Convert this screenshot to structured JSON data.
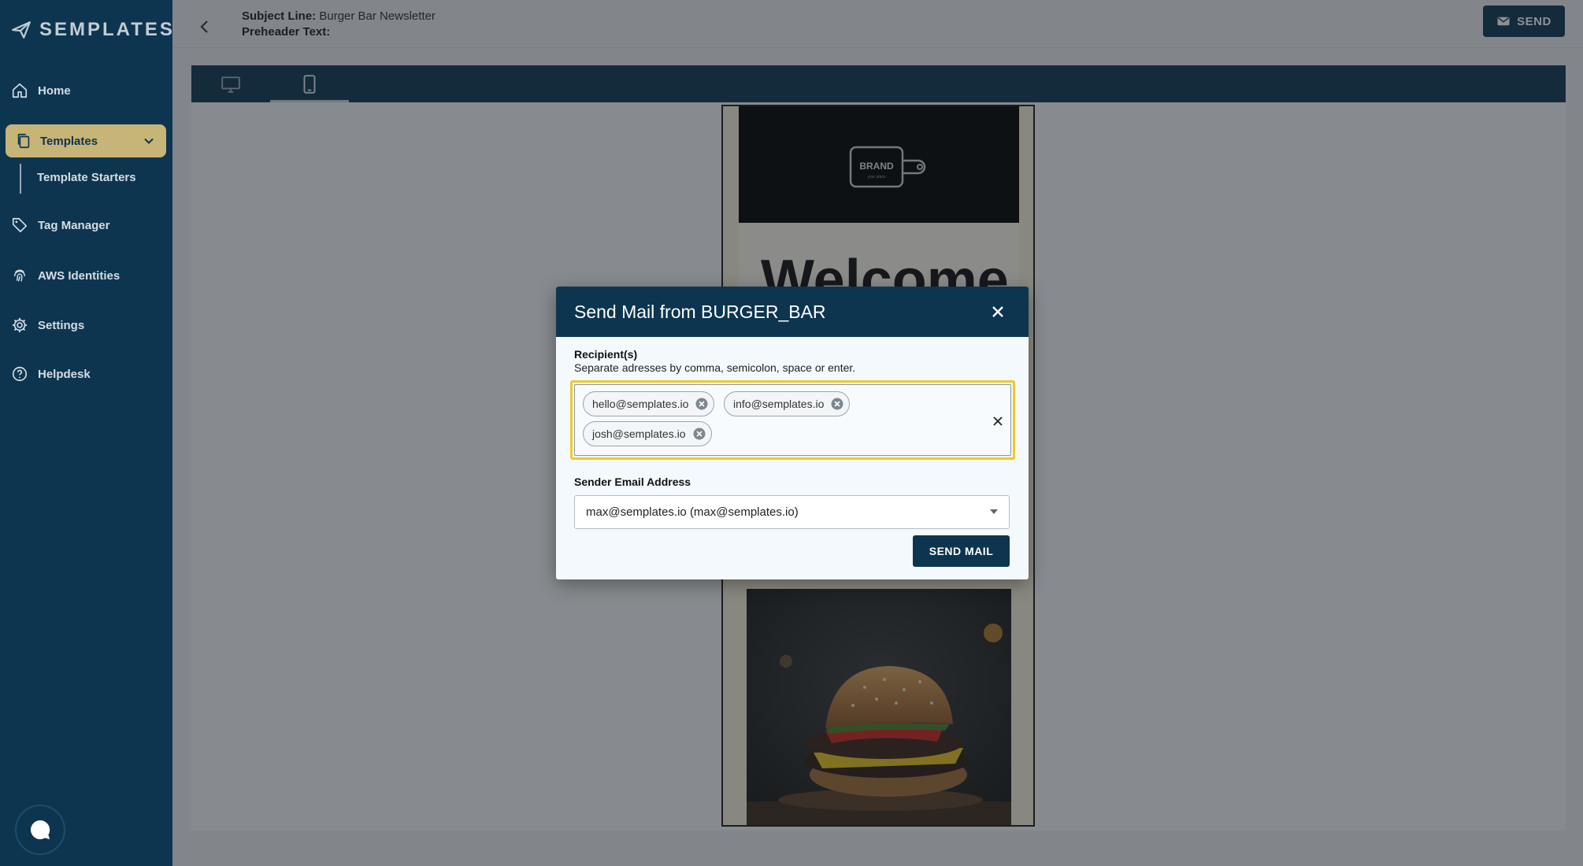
{
  "brand": {
    "name": "SEMPLATES"
  },
  "sidebar": {
    "items": [
      {
        "label": "Home",
        "icon": "home-icon"
      },
      {
        "label": "Templates",
        "icon": "copy-icon"
      },
      {
        "label": "Template Starters"
      },
      {
        "label": "Tag Manager",
        "icon": "tag-icon"
      },
      {
        "label": "AWS Identities",
        "icon": "fingerprint-icon"
      },
      {
        "label": "Settings",
        "icon": "gear-icon"
      },
      {
        "label": "Helpdesk",
        "icon": "help-icon"
      }
    ],
    "active": "Templates"
  },
  "header": {
    "subject_label": "Subject Line:",
    "subject_value": "Burger Bar Newsletter",
    "preheader_label": "Preheader Text:",
    "preheader_value": "",
    "send_label": "SEND"
  },
  "preview": {
    "modes": [
      "desktop",
      "mobile"
    ],
    "active_mode": "mobile",
    "brand_logo_text": "BRAND",
    "brand_logo_sub": "your place",
    "welcome_text": "Welcome"
  },
  "modal": {
    "title": "Send Mail from BURGER_BAR",
    "recipients_label": "Recipient(s)",
    "recipients_hint": "Separate adresses by comma, semicolon, space or enter.",
    "recipients": [
      "hello@semplates.io",
      "info@semplates.io",
      "josh@semplates.io"
    ],
    "sender_label": "Sender Email Address",
    "sender_value": "max@semplates.io (max@semplates.io)",
    "submit_label": "SEND MAIL"
  },
  "colors": {
    "primary": "#0d3550",
    "accent": "#c7b477",
    "focus": "#f0c92c"
  }
}
